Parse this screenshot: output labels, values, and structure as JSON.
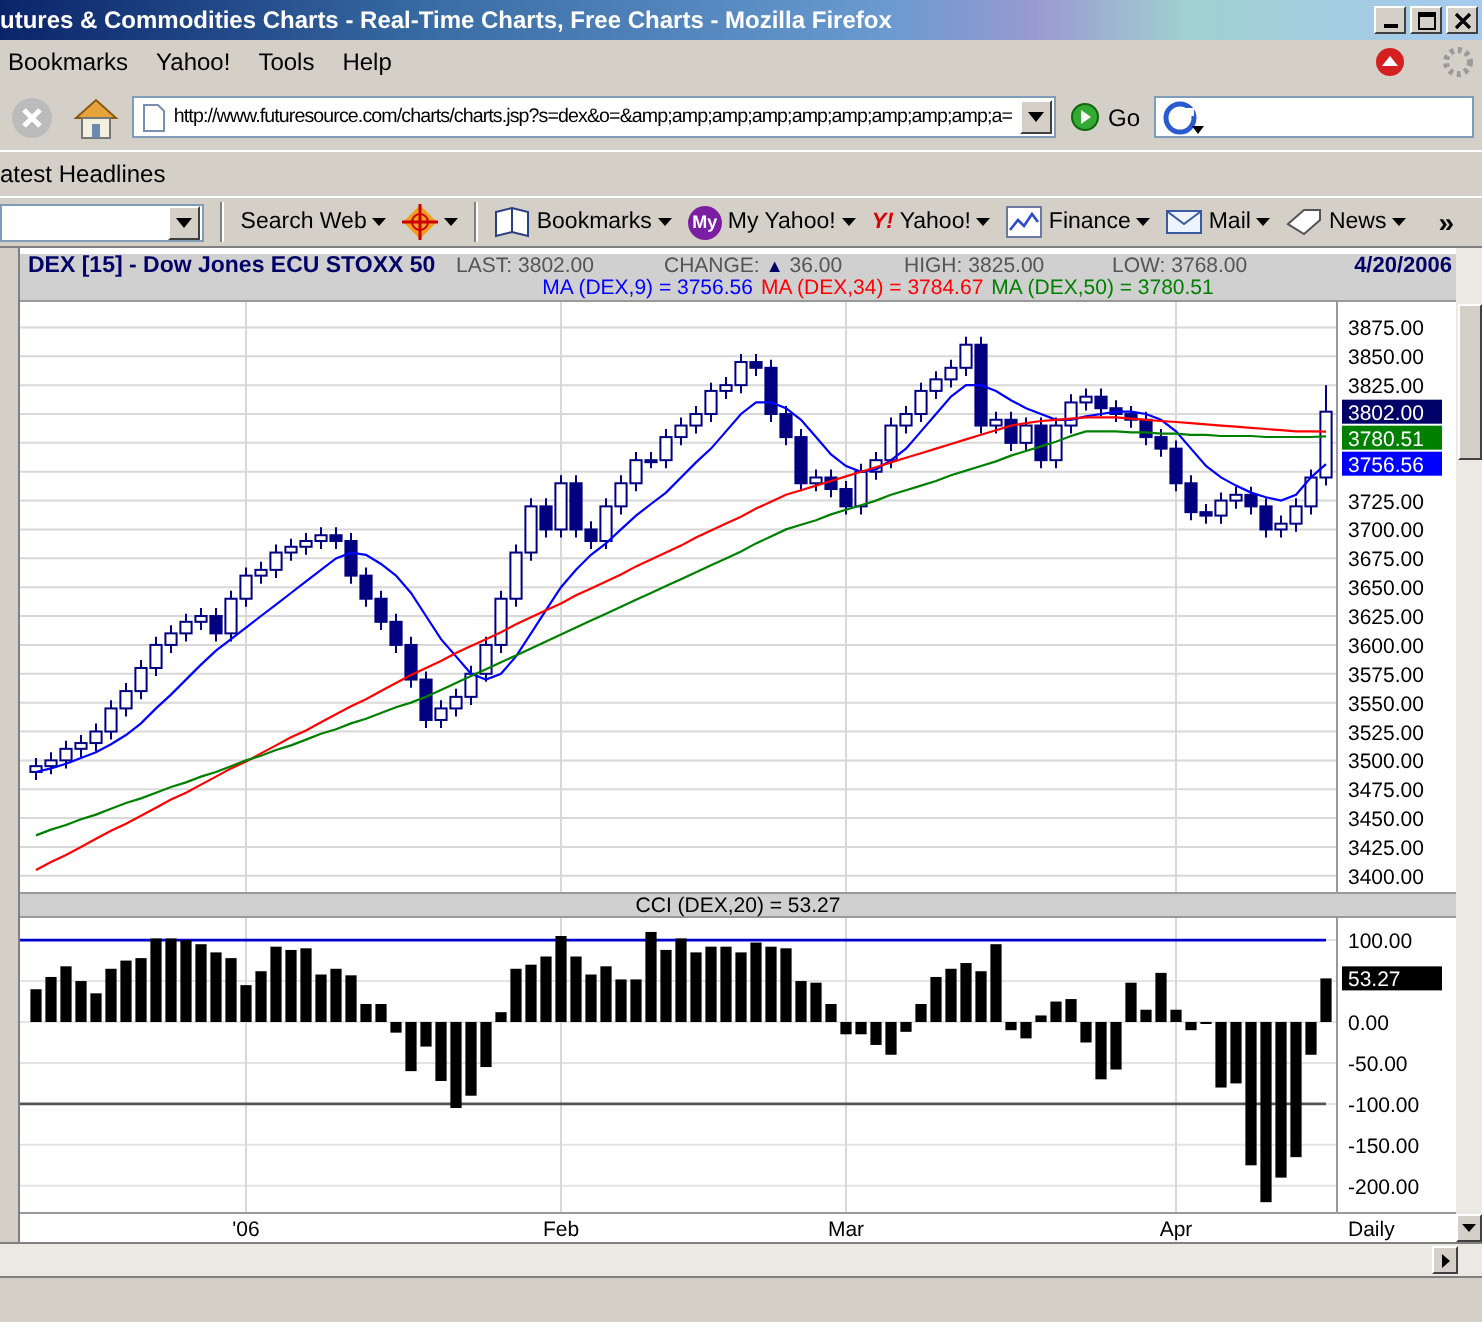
{
  "window": {
    "title": "utures & Commodities Charts - Real-Time Charts, Free Charts - Mozilla Firefox"
  },
  "menu": [
    "Bookmarks",
    "Yahoo!",
    "Tools",
    "Help"
  ],
  "nav": {
    "url": "http://www.futuresource.com/charts/charts.jsp?s=dex&o=&amp;amp;amp;amp;amp;amp;amp;amp;amp;a=",
    "go": "Go"
  },
  "bookmarks_bar": [
    "atest Headlines"
  ],
  "yahoo_toolbar": {
    "search_label": "Search Web",
    "links": [
      {
        "label": "Bookmarks"
      },
      {
        "label": "My Yahoo!",
        "badge": "My"
      },
      {
        "label": "Yahoo!",
        "badge": "Y!"
      },
      {
        "label": "Finance"
      },
      {
        "label": "Mail"
      },
      {
        "label": "News"
      }
    ],
    "overflow": "»"
  },
  "price_panel": {
    "symbol": "DEX [15] - Dow Jones ECU STOXX 50",
    "stats": [
      {
        "label": "LAST:",
        "value": "3802.00"
      },
      {
        "label": "CHANGE:",
        "arrow": "▲",
        "value": "36.00"
      },
      {
        "label": "HIGH:",
        "value": "3825.00"
      },
      {
        "label": "LOW:",
        "value": "3768.00"
      }
    ],
    "date": "4/20/2006",
    "ma_labels": [
      {
        "value": "= 3756.56"
      },
      {
        "value": "= 3784.67"
      },
      {
        "value": "= 3780.51"
      }
    ],
    "price_tags": [
      {
        "text": "3802.00",
        "color": "#000066"
      },
      {
        "text": "3780.51",
        "color": "#008000"
      },
      {
        "text": "3756.56",
        "color": "#0000ff"
      }
    ],
    "chart_data": {
      "type": "candlestick",
      "grid": true,
      "ylim": [
        3386,
        3897
      ],
      "categories": [
        null,
        null,
        null,
        null,
        null,
        null,
        null,
        null,
        null,
        null,
        null,
        null,
        null,
        null,
        null,
        null,
        null,
        null,
        null,
        null,
        null,
        null,
        null,
        null,
        null,
        null,
        null,
        null,
        null,
        null,
        null,
        null,
        null,
        null,
        null,
        null,
        null,
        null,
        null,
        null,
        null,
        null,
        null,
        null,
        null,
        null,
        null,
        null,
        null,
        null,
        null,
        null,
        null,
        null,
        null,
        null,
        null,
        null,
        null,
        null,
        null,
        null,
        null,
        null,
        null,
        null,
        null,
        null,
        null,
        null,
        null,
        null,
        null,
        null,
        null,
        null,
        null,
        null,
        null,
        null,
        null,
        null,
        null,
        null,
        null,
        null,
        null
      ],
      "yticks": [
        {
          "value": 3875,
          "label": "3875.00"
        },
        {
          "value": 3850,
          "label": "3850.00"
        },
        {
          "value": 3825,
          "label": "3825.00"
        },
        {
          "value": 3725,
          "label": "3725.00"
        },
        {
          "value": 3700,
          "label": "3700.00"
        },
        {
          "value": 3675,
          "label": "3675.00"
        },
        {
          "value": 3650,
          "label": "3650.00"
        },
        {
          "value": 3625,
          "label": "3625.00"
        },
        {
          "value": 3600,
          "label": "3600.00"
        },
        {
          "value": 3575,
          "label": "3575.00"
        },
        {
          "value": 3550,
          "label": "3550.00"
        },
        {
          "value": 3525,
          "label": "3525.00"
        },
        {
          "value": 3500,
          "label": "3500.00"
        },
        {
          "value": 3475,
          "label": "3475.00"
        },
        {
          "value": 3450,
          "label": "3450.00"
        },
        {
          "value": 3425,
          "label": "3425.00"
        },
        {
          "value": 3400,
          "label": "3400.00"
        }
      ],
      "ohlc": [
        [
          3490,
          3502,
          3483,
          3495
        ],
        [
          3495,
          3507,
          3488,
          3500
        ],
        [
          3500,
          3517,
          3493,
          3510
        ],
        [
          3510,
          3522,
          3503,
          3515
        ],
        [
          3515,
          3532,
          3508,
          3525
        ],
        [
          3525,
          3552,
          3518,
          3545
        ],
        [
          3545,
          3567,
          3538,
          3560
        ],
        [
          3560,
          3587,
          3553,
          3580
        ],
        [
          3580,
          3607,
          3573,
          3600
        ],
        [
          3600,
          3617,
          3593,
          3610
        ],
        [
          3610,
          3627,
          3603,
          3620
        ],
        [
          3620,
          3632,
          3613,
          3625
        ],
        [
          3625,
          3632,
          3603,
          3610
        ],
        [
          3610,
          3647,
          3603,
          3640
        ],
        [
          3640,
          3667,
          3633,
          3660
        ],
        [
          3660,
          3672,
          3653,
          3665
        ],
        [
          3665,
          3687,
          3658,
          3680
        ],
        [
          3680,
          3692,
          3673,
          3685
        ],
        [
          3685,
          3697,
          3678,
          3690
        ],
        [
          3690,
          3702,
          3683,
          3695
        ],
        [
          3695,
          3702,
          3683,
          3690
        ],
        [
          3690,
          3697,
          3653,
          3660
        ],
        [
          3660,
          3667,
          3633,
          3640
        ],
        [
          3640,
          3647,
          3613,
          3620
        ],
        [
          3620,
          3627,
          3593,
          3600
        ],
        [
          3600,
          3607,
          3563,
          3570
        ],
        [
          3570,
          3577,
          3528,
          3535
        ],
        [
          3535,
          3552,
          3528,
          3545
        ],
        [
          3545,
          3562,
          3538,
          3555
        ],
        [
          3555,
          3582,
          3548,
          3575
        ],
        [
          3575,
          3607,
          3568,
          3600
        ],
        [
          3600,
          3647,
          3593,
          3640
        ],
        [
          3640,
          3687,
          3633,
          3680
        ],
        [
          3680,
          3727,
          3673,
          3720
        ],
        [
          3720,
          3727,
          3693,
          3700
        ],
        [
          3700,
          3747,
          3693,
          3740
        ],
        [
          3740,
          3747,
          3693,
          3700
        ],
        [
          3700,
          3707,
          3683,
          3690
        ],
        [
          3690,
          3727,
          3683,
          3720
        ],
        [
          3720,
          3747,
          3713,
          3740
        ],
        [
          3740,
          3767,
          3733,
          3760
        ],
        [
          3760,
          3767,
          3753,
          3760
        ],
        [
          3760,
          3787,
          3753,
          3780
        ],
        [
          3780,
          3797,
          3773,
          3790
        ],
        [
          3790,
          3807,
          3783,
          3800
        ],
        [
          3800,
          3827,
          3793,
          3820
        ],
        [
          3820,
          3832,
          3813,
          3825
        ],
        [
          3825,
          3852,
          3818,
          3845
        ],
        [
          3845,
          3852,
          3833,
          3840
        ],
        [
          3840,
          3847,
          3793,
          3800
        ],
        [
          3800,
          3807,
          3773,
          3780
        ],
        [
          3780,
          3787,
          3733,
          3740
        ],
        [
          3740,
          3752,
          3733,
          3745
        ],
        [
          3745,
          3752,
          3728,
          3735
        ],
        [
          3735,
          3742,
          3713,
          3720
        ],
        [
          3720,
          3757,
          3713,
          3750
        ],
        [
          3750,
          3767,
          3743,
          3760
        ],
        [
          3760,
          3797,
          3753,
          3790
        ],
        [
          3790,
          3807,
          3783,
          3800
        ],
        [
          3800,
          3827,
          3793,
          3820
        ],
        [
          3820,
          3837,
          3813,
          3830
        ],
        [
          3830,
          3847,
          3823,
          3840
        ],
        [
          3840,
          3867,
          3833,
          3860
        ],
        [
          3860,
          3867,
          3783,
          3790
        ],
        [
          3790,
          3802,
          3783,
          3795
        ],
        [
          3795,
          3802,
          3768,
          3775
        ],
        [
          3775,
          3797,
          3768,
          3790
        ],
        [
          3790,
          3797,
          3753,
          3760
        ],
        [
          3760,
          3797,
          3753,
          3790
        ],
        [
          3790,
          3817,
          3783,
          3810
        ],
        [
          3810,
          3822,
          3803,
          3815
        ],
        [
          3815,
          3822,
          3798,
          3805
        ],
        [
          3805,
          3812,
          3793,
          3800
        ],
        [
          3800,
          3807,
          3788,
          3795
        ],
        [
          3795,
          3802,
          3773,
          3780
        ],
        [
          3780,
          3787,
          3763,
          3770
        ],
        [
          3770,
          3777,
          3733,
          3740
        ],
        [
          3740,
          3747,
          3708,
          3715
        ],
        [
          3715,
          3722,
          3705,
          3712
        ],
        [
          3712,
          3732,
          3705,
          3725
        ],
        [
          3725,
          3737,
          3718,
          3730
        ],
        [
          3730,
          3737,
          3713,
          3720
        ],
        [
          3720,
          3727,
          3693,
          3700
        ],
        [
          3700,
          3712,
          3693,
          3705
        ],
        [
          3705,
          3727,
          3698,
          3720
        ],
        [
          3720,
          3752,
          3713,
          3745
        ],
        [
          3745,
          3825,
          3738,
          3802
        ]
      ],
      "series": [
        {
          "name": "MA (DEX,9)",
          "type": "line",
          "color": "#0000ff",
          "values": [
            3490,
            3493,
            3497,
            3502,
            3507,
            3514,
            3522,
            3532,
            3545,
            3557,
            3570,
            3583,
            3595,
            3605,
            3615,
            3625,
            3635,
            3645,
            3655,
            3665,
            3675,
            3680,
            3678,
            3670,
            3660,
            3645,
            3625,
            3605,
            3590,
            3575,
            3570,
            3575,
            3590,
            3610,
            3630,
            3650,
            3665,
            3678,
            3688,
            3700,
            3712,
            3722,
            3732,
            3745,
            3758,
            3770,
            3785,
            3800,
            3810,
            3810,
            3805,
            3795,
            3780,
            3765,
            3755,
            3750,
            3752,
            3760,
            3770,
            3785,
            3800,
            3815,
            3825,
            3825,
            3820,
            3812,
            3805,
            3800,
            3795,
            3795,
            3798,
            3800,
            3802,
            3802,
            3800,
            3795,
            3785,
            3770,
            3755,
            3745,
            3738,
            3732,
            3728,
            3725,
            3730,
            3745,
            3756.56
          ]
        },
        {
          "name": "MA (DEX,34)",
          "type": "line",
          "color": "#ff0000",
          "values": [
            3405,
            3412,
            3418,
            3425,
            3432,
            3439,
            3445,
            3452,
            3459,
            3466,
            3472,
            3479,
            3486,
            3493,
            3499,
            3506,
            3513,
            3520,
            3526,
            3533,
            3540,
            3547,
            3553,
            3560,
            3567,
            3574,
            3580,
            3586,
            3593,
            3599,
            3605,
            3611,
            3618,
            3624,
            3630,
            3636,
            3643,
            3649,
            3655,
            3661,
            3668,
            3674,
            3680,
            3686,
            3693,
            3699,
            3705,
            3711,
            3718,
            3724,
            3730,
            3734,
            3738,
            3742,
            3746,
            3750,
            3754,
            3758,
            3762,
            3766,
            3770,
            3774,
            3778,
            3782,
            3786,
            3790,
            3792,
            3794,
            3795,
            3796,
            3797,
            3797,
            3797,
            3796,
            3795,
            3794,
            3793,
            3792,
            3791,
            3790,
            3789,
            3788,
            3787,
            3786,
            3785,
            3785,
            3784.67
          ]
        },
        {
          "name": "MA (DEX,50)",
          "type": "line",
          "color": "#008000",
          "values": [
            3435,
            3440,
            3444,
            3449,
            3453,
            3458,
            3463,
            3467,
            3472,
            3477,
            3481,
            3486,
            3490,
            3495,
            3500,
            3504,
            3509,
            3513,
            3518,
            3523,
            3527,
            3532,
            3536,
            3541,
            3546,
            3550,
            3555,
            3561,
            3567,
            3573,
            3579,
            3585,
            3591,
            3597,
            3603,
            3609,
            3615,
            3621,
            3627,
            3633,
            3639,
            3645,
            3651,
            3657,
            3663,
            3669,
            3675,
            3681,
            3688,
            3694,
            3700,
            3704,
            3708,
            3713,
            3717,
            3721,
            3725,
            3730,
            3734,
            3738,
            3742,
            3747,
            3751,
            3755,
            3759,
            3764,
            3768,
            3772,
            3776,
            3781,
            3785,
            3785,
            3785,
            3784,
            3784,
            3783,
            3783,
            3782,
            3782,
            3781,
            3781,
            3781,
            3780,
            3780,
            3780,
            3780,
            3780.51
          ]
        }
      ]
    }
  },
  "cci_panel": {
    "title": "CCI (DEX,20) = 53.27",
    "value_tag": "53.27",
    "period_label": "Daily",
    "chart_data": {
      "type": "bar",
      "grid": true,
      "ylim": [
        -232,
        127
      ],
      "categories": [
        null,
        null,
        null,
        null,
        null,
        null,
        null,
        null,
        null,
        null,
        null,
        null,
        null,
        null,
        "'06",
        null,
        null,
        null,
        null,
        null,
        null,
        null,
        null,
        null,
        null,
        null,
        null,
        null,
        null,
        null,
        null,
        null,
        null,
        null,
        null,
        "Feb",
        null,
        null,
        null,
        null,
        null,
        null,
        null,
        null,
        null,
        null,
        null,
        null,
        null,
        null,
        null,
        null,
        null,
        null,
        "Mar",
        null,
        null,
        null,
        null,
        null,
        null,
        null,
        null,
        null,
        null,
        null,
        null,
        null,
        null,
        null,
        null,
        null,
        null,
        null,
        null,
        null,
        "Apr",
        null,
        null,
        null,
        null,
        null,
        null,
        null,
        null,
        null,
        null
      ],
      "yticks": [
        {
          "value": 100,
          "label": "100.00"
        },
        {
          "value": 0,
          "label": "0.00"
        },
        {
          "value": -50,
          "label": "-50.00"
        },
        {
          "value": -100,
          "label": "-100.00"
        },
        {
          "value": -150,
          "label": "-150.00"
        },
        {
          "value": -200,
          "label": "-200.00"
        }
      ],
      "ref_lines": [
        {
          "axis": "y",
          "value": 100,
          "color": "#0000cc"
        },
        {
          "axis": "y",
          "value": -100,
          "color": "#555555"
        }
      ],
      "values": [
        40,
        55,
        68,
        50,
        35,
        65,
        75,
        78,
        102,
        102,
        100,
        95,
        85,
        78,
        45,
        62,
        92,
        88,
        90,
        58,
        65,
        57,
        22,
        22,
        -13,
        -60,
        -30,
        -72,
        -105,
        -90,
        -55,
        12,
        65,
        70,
        80,
        105,
        80,
        58,
        68,
        52,
        52,
        110,
        88,
        102,
        85,
        92,
        92,
        85,
        97,
        92,
        90,
        50,
        48,
        22,
        -15,
        -15,
        -28,
        -40,
        -12,
        22,
        55,
        65,
        72,
        62,
        95,
        -10,
        -20,
        8,
        25,
        28,
        -25,
        -70,
        -58,
        48,
        15,
        60,
        15,
        -10,
        -1,
        -80,
        -75,
        -175,
        -220,
        -190,
        -165,
        -40,
        53.27
      ]
    }
  }
}
